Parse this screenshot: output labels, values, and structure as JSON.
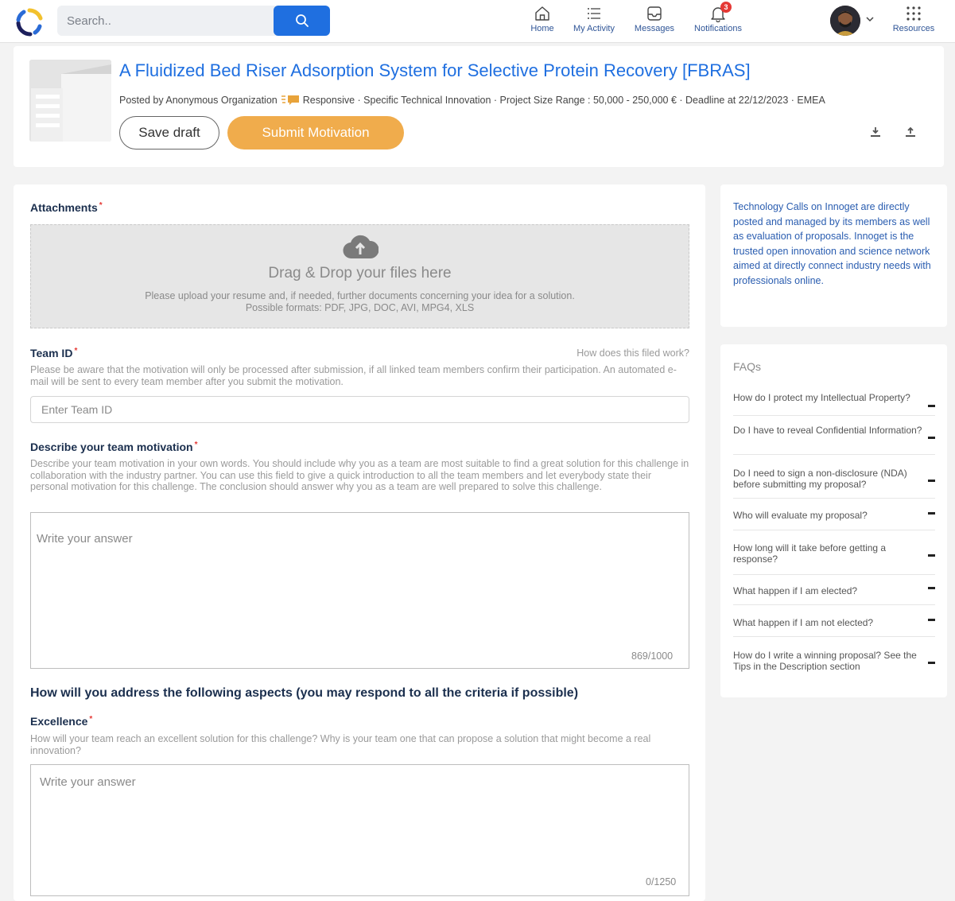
{
  "nav": {
    "search_placeholder": "Search..",
    "home": "Home",
    "activity": "My Activity",
    "messages": "Messages",
    "notifications": "Notifications",
    "notification_count": "3",
    "resources": "Resources"
  },
  "header": {
    "title": "A Fluidized Bed Riser Adsorption System for Selective Protein Recovery [FBRAS]",
    "posted_by": "Posted by Anonymous Organization",
    "meta_rest": "Responsive · Specific Technical Innovation · Project Size Range : 50,000 - 250,000 € · Deadline at 22/12/2023 · EMEA",
    "save_label": "Save draft",
    "submit_label": "Submit Motivation"
  },
  "form": {
    "attachments_label": "Attachments",
    "dropzone_title": "Drag & Drop your files here",
    "dropzone_line1": "Please upload your resume and, if needed, further documents concerning your idea for a solution.",
    "dropzone_line2": "Possible formats: PDF, JPG, DOC, AVI, MPG4, XLS",
    "team_label": "Team ID",
    "team_help_link": "How does this filed work?",
    "team_help": "Please be aware that the motivation will only be processed after submission, if all linked team members confirm their participation. An automated e-mail will be sent to every team member after you submit the motivation.",
    "team_placeholder": "Enter Team ID",
    "motivation_label": "Describe your team motivation",
    "motivation_help": "Describe your team motivation in your own words. You should include why you as a team are most suitable to find a great solution for this challenge in collaboration with the industry partner. You can use this field to give a quick introduction to all the team members and let everybody state their personal motivation for this challenge. The conclusion should answer why you as a team are well prepared to solve this challenge.",
    "motivation_placeholder": "Write your answer",
    "motivation_counter": "869/1000",
    "aspects_heading": "How will you address the following aspects (you may respond to all the criteria if possible)",
    "excellence_label": "Excellence",
    "excellence_help": "How will your team reach an excellent solution for this challenge? Why is your team one that can propose a solution that might become a real innovation?",
    "excellence_placeholder": "Write your answer",
    "excellence_counter": "0/1250"
  },
  "sidebar": {
    "info": "Technology Calls on Innoget are directly posted and managed by its members as well as evaluation of proposals. Innoget is the trusted open innovation and science network aimed at directly connect industry needs with professionals online.",
    "faq_title": "FAQs",
    "faqs": [
      "How do I protect my Intellectual Property?",
      "Do I have to reveal Confidential Information?",
      "Do I need to sign a non-disclosure (NDA) before submitting my proposal?",
      "Who will evaluate my proposal?",
      "How long will it take before getting a response?",
      "What happen if I am elected?",
      "What happen if I am not elected?",
      "How do I write a winning proposal? See the Tips in the Description section"
    ]
  },
  "colors": {
    "primary_blue": "#1f6fe0",
    "submit_orange": "#f0ac4c",
    "required_red": "#e53935"
  },
  "icons": [
    "logo",
    "search-icon",
    "home-icon",
    "activity-icon",
    "messages-icon",
    "bell-icon",
    "grid-icon",
    "download-icon",
    "upload-icon",
    "cloud-upload-icon",
    "chat-icon"
  ]
}
